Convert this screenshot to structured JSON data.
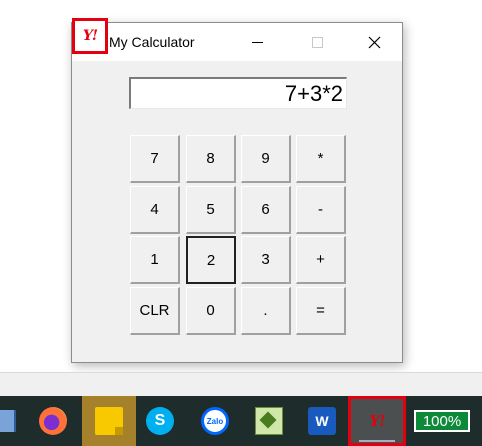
{
  "window": {
    "title": "My Calculator",
    "app_icon": "yahoo-y-icon",
    "app_icon_text": "Y!",
    "controls": [
      "minimize-icon",
      "maximize-icon",
      "close-icon"
    ]
  },
  "display": {
    "value": "7+3*2"
  },
  "keypad": {
    "rows": [
      [
        "7",
        "8",
        "9",
        "*"
      ],
      [
        "4",
        "5",
        "6",
        "-"
      ],
      [
        "1",
        "2",
        "3",
        "+"
      ],
      [
        "CLR",
        "0",
        ".",
        "="
      ]
    ],
    "focused_key": "2"
  },
  "taskbar": {
    "apps": [
      {
        "name": "window-icon-partial"
      },
      {
        "name": "firefox-icon"
      },
      {
        "name": "sticky-notes-icon",
        "active": true
      },
      {
        "name": "skype-icon",
        "label": "S"
      },
      {
        "name": "zalo-icon",
        "label": "Zalo"
      },
      {
        "name": "notepad-plus-icon"
      },
      {
        "name": "word-icon",
        "label": "W"
      },
      {
        "name": "yahoo-calculator-app-icon",
        "label": "Y!",
        "highlighted": true
      }
    ],
    "battery": "100%"
  },
  "colors": {
    "highlight_red": "#e3000f",
    "taskbar_bg": "#1e2d2b",
    "battery_green": "#0c8a3a"
  }
}
